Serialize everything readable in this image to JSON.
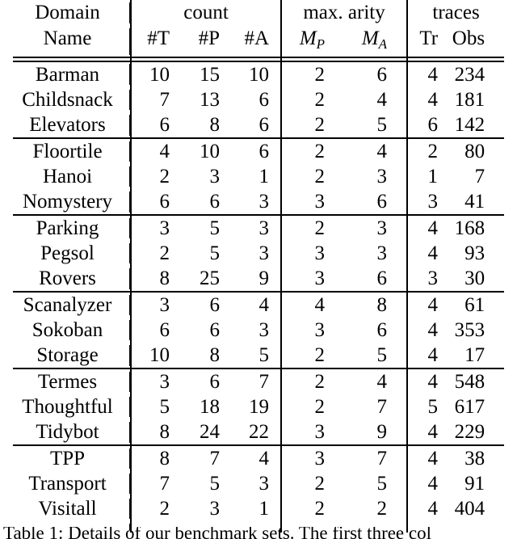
{
  "table": {
    "header": {
      "row1": {
        "domain": "Domain",
        "count": "count",
        "max_arity": "max. arity",
        "traces": "traces"
      },
      "row2": {
        "name": "Name",
        "t": "#T",
        "p": "#P",
        "a": "#A",
        "mp": "M",
        "mp_sub": "P",
        "ma": "M",
        "ma_sub": "A",
        "tr": "Tr",
        "obs": "Obs"
      }
    },
    "groups": [
      {
        "rows": [
          {
            "name": "Barman",
            "t": "10",
            "p": "15",
            "a": "10",
            "mp": "2",
            "ma": "6",
            "tr": "4",
            "obs": "234"
          },
          {
            "name": "Childsnack",
            "t": "7",
            "p": "13",
            "a": "6",
            "mp": "2",
            "ma": "4",
            "tr": "4",
            "obs": "181"
          },
          {
            "name": "Elevators",
            "t": "6",
            "p": "8",
            "a": "6",
            "mp": "2",
            "ma": "5",
            "tr": "6",
            "obs": "142"
          }
        ]
      },
      {
        "rows": [
          {
            "name": "Floortile",
            "t": "4",
            "p": "10",
            "a": "6",
            "mp": "2",
            "ma": "4",
            "tr": "2",
            "obs": "80"
          },
          {
            "name": "Hanoi",
            "t": "2",
            "p": "3",
            "a": "1",
            "mp": "2",
            "ma": "3",
            "tr": "1",
            "obs": "7"
          },
          {
            "name": "Nomystery",
            "t": "6",
            "p": "6",
            "a": "3",
            "mp": "3",
            "ma": "6",
            "tr": "3",
            "obs": "41"
          }
        ]
      },
      {
        "rows": [
          {
            "name": "Parking",
            "t": "3",
            "p": "5",
            "a": "3",
            "mp": "2",
            "ma": "3",
            "tr": "4",
            "obs": "168"
          },
          {
            "name": "Pegsol",
            "t": "2",
            "p": "5",
            "a": "3",
            "mp": "3",
            "ma": "3",
            "tr": "4",
            "obs": "93"
          },
          {
            "name": "Rovers",
            "t": "8",
            "p": "25",
            "a": "9",
            "mp": "3",
            "ma": "6",
            "tr": "3",
            "obs": "30"
          }
        ]
      },
      {
        "rows": [
          {
            "name": "Scanalyzer",
            "t": "3",
            "p": "6",
            "a": "4",
            "mp": "4",
            "ma": "8",
            "tr": "4",
            "obs": "61"
          },
          {
            "name": "Sokoban",
            "t": "6",
            "p": "6",
            "a": "3",
            "mp": "3",
            "ma": "6",
            "tr": "4",
            "obs": "353"
          },
          {
            "name": "Storage",
            "t": "10",
            "p": "8",
            "a": "5",
            "mp": "2",
            "ma": "5",
            "tr": "4",
            "obs": "17"
          }
        ]
      },
      {
        "rows": [
          {
            "name": "Termes",
            "t": "3",
            "p": "6",
            "a": "7",
            "mp": "2",
            "ma": "4",
            "tr": "4",
            "obs": "548"
          },
          {
            "name": "Thoughtful",
            "t": "5",
            "p": "18",
            "a": "19",
            "mp": "2",
            "ma": "7",
            "tr": "5",
            "obs": "617"
          },
          {
            "name": "Tidybot",
            "t": "8",
            "p": "24",
            "a": "22",
            "mp": "3",
            "ma": "9",
            "tr": "4",
            "obs": "229"
          }
        ]
      },
      {
        "rows": [
          {
            "name": "TPP",
            "t": "8",
            "p": "7",
            "a": "4",
            "mp": "3",
            "ma": "7",
            "tr": "4",
            "obs": "38"
          },
          {
            "name": "Transport",
            "t": "7",
            "p": "5",
            "a": "3",
            "mp": "2",
            "ma": "5",
            "tr": "4",
            "obs": "91"
          },
          {
            "name": "Visitall",
            "t": "2",
            "p": "3",
            "a": "1",
            "mp": "2",
            "ma": "2",
            "tr": "4",
            "obs": "404"
          }
        ]
      }
    ]
  },
  "caption": {
    "text": "Table 1: Details of our benchmark sets. The first three col"
  }
}
